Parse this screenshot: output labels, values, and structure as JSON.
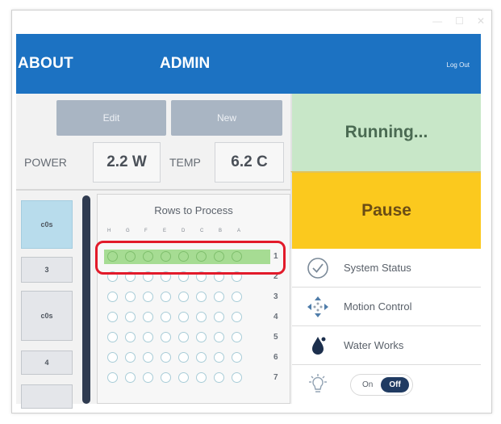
{
  "window": {
    "controls": [
      "—",
      "☐",
      "✕"
    ]
  },
  "topbar": {
    "nav_about": "ABOUT",
    "nav_admin": "ADMIN",
    "logout": "Log Out"
  },
  "toolbar": {
    "edit_label": "Edit",
    "new_label": "New"
  },
  "metrics": {
    "power_label": "POWER",
    "power_value": "2.2 W",
    "temp_label": "TEMP",
    "temp_value": "6.2 C"
  },
  "left_col": {
    "items": [
      "c0s",
      "3",
      "c0s",
      "4",
      ""
    ]
  },
  "rows_panel": {
    "title": "Rows to Process",
    "columns": [
      "H",
      "G",
      "F",
      "E",
      "D",
      "C",
      "B",
      "A"
    ],
    "rows": [
      {
        "num": "1",
        "selected": true
      },
      {
        "num": "2",
        "selected": false
      },
      {
        "num": "3",
        "selected": false
      },
      {
        "num": "4",
        "selected": false
      },
      {
        "num": "5",
        "selected": false
      },
      {
        "num": "6",
        "selected": false
      },
      {
        "num": "7",
        "selected": false
      }
    ]
  },
  "status": {
    "running_label": "Running...",
    "pause_label": "Pause"
  },
  "sidemenu": {
    "system_status": "System Status",
    "motion_control": "Motion Control",
    "water_works": "Water Works",
    "toggle_on": "On",
    "toggle_off": "Off"
  },
  "colors": {
    "topbar": "#1c72c2",
    "running_bg": "#c8e7c8",
    "pause_bg": "#fbc91e",
    "highlight": "#e21a2a",
    "selected_row": "#a6dc93",
    "toggle_active": "#203b62"
  }
}
